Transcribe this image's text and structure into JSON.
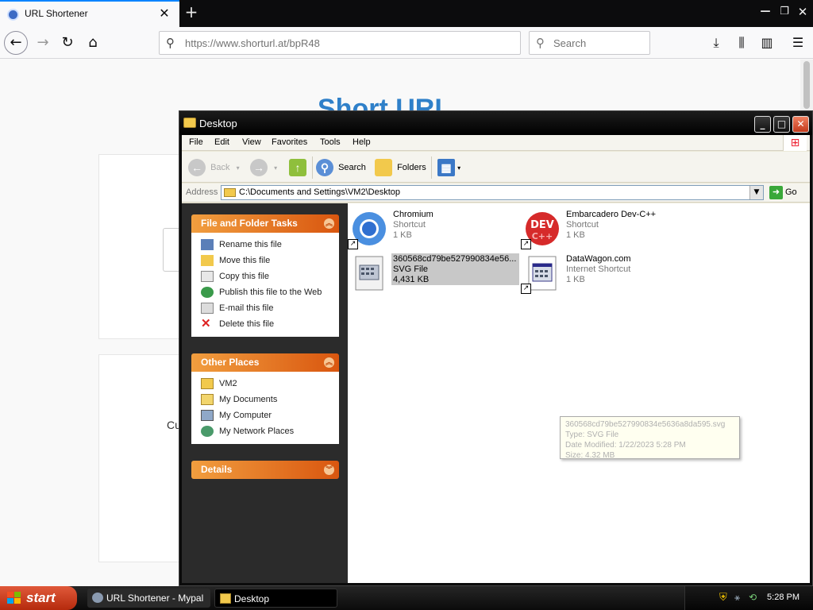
{
  "browser": {
    "tab_title": "URL Shortener",
    "tab_close": "✕",
    "new_tab": "+",
    "url": "https://www.shorturl.at/bpR48",
    "search_placeholder": "Search"
  },
  "page": {
    "title": "Short URL",
    "card2_text": "Cu"
  },
  "explorer": {
    "title": "Desktop",
    "menu": [
      "File",
      "Edit",
      "View",
      "Favorites",
      "Tools",
      "Help"
    ],
    "toolbar": {
      "back": "Back",
      "search": "Search",
      "folders": "Folders"
    },
    "address_label": "Address",
    "address_path": "C:\\Documents and Settings\\VM2\\Desktop",
    "go_label": "Go",
    "tasks_header": "File and Folder Tasks",
    "tasks": [
      "Rename this file",
      "Move this file",
      "Copy this file",
      "Publish this file to the Web",
      "E-mail this file",
      "Delete this file"
    ],
    "places_header": "Other Places",
    "places": [
      "VM2",
      "My Documents",
      "My Computer",
      "My Network Places"
    ],
    "details_header": "Details",
    "files": [
      {
        "name": "Chromium",
        "type": "Shortcut",
        "size": "1 KB",
        "icon": "chromium-icon"
      },
      {
        "name": "Embarcadero Dev-C++",
        "type": "Shortcut",
        "size": "1 KB",
        "icon": "devcpp-icon"
      },
      {
        "name": "360568cd79be527990834e56...",
        "type": "SVG File",
        "size": "4,431 KB",
        "icon": "svg-file-icon"
      },
      {
        "name": "DataWagon.com",
        "type": "Internet Shortcut",
        "size": "1 KB",
        "icon": "internet-shortcut-icon"
      }
    ],
    "tooltip": [
      "360568cd79be527990834e5636a8da595.svg",
      "Type: SVG File",
      "Date Modified: 1/22/2023 5:28 PM",
      "Size: 4.32 MB"
    ]
  },
  "taskbar": {
    "start": "start",
    "tasks": [
      "URL Shortener - Mypal",
      "Desktop"
    ],
    "clock": "5:28 PM"
  },
  "colors": {
    "xp_orange": "#d9560f",
    "firefox_blue": "#0a84ff",
    "start_red": "#c4381a"
  }
}
